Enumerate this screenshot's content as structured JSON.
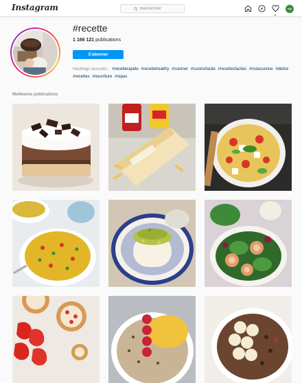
{
  "app": {
    "logo_text": "Instagram"
  },
  "search": {
    "placeholder": "Rechercher"
  },
  "nav": {
    "icons": [
      "home-icon",
      "explore-icon",
      "activity-heart-icon"
    ],
    "avatar_text": "kai",
    "notification_color": "#ed4956"
  },
  "header": {
    "hashtag": "#recette",
    "publications_count": "1 166 121",
    "publications_label": "publications",
    "follow_label": "S'abonner",
    "related_label": "Hashtags associés :",
    "related_tags": [
      "#recetterapide",
      "#recettehealthy",
      "#cuisiner",
      "#cuisinefacile",
      "#recettesfaciles",
      "#instacuisine",
      "#délice",
      "#recettes",
      "#nourriture",
      "#repas"
    ]
  },
  "section": {
    "title": "Meilleures publications"
  },
  "colors": {
    "accent": "#0095f6",
    "link": "#00376b",
    "muted": "#8e8e8e"
  },
  "posts": [
    {
      "subject": "chocolate-cream-cake"
    },
    {
      "subject": "wrap-with-ketchup"
    },
    {
      "subject": "pasta-salad"
    },
    {
      "subject": "yellow-rice-bowl"
    },
    {
      "subject": "panna-cotta-pistachio"
    },
    {
      "subject": "salmon-rolls-salad"
    },
    {
      "subject": "strawberry-tartlets"
    },
    {
      "subject": "oatmeal-raspberry-bowl"
    },
    {
      "subject": "banana-chocolate-bowl"
    }
  ]
}
